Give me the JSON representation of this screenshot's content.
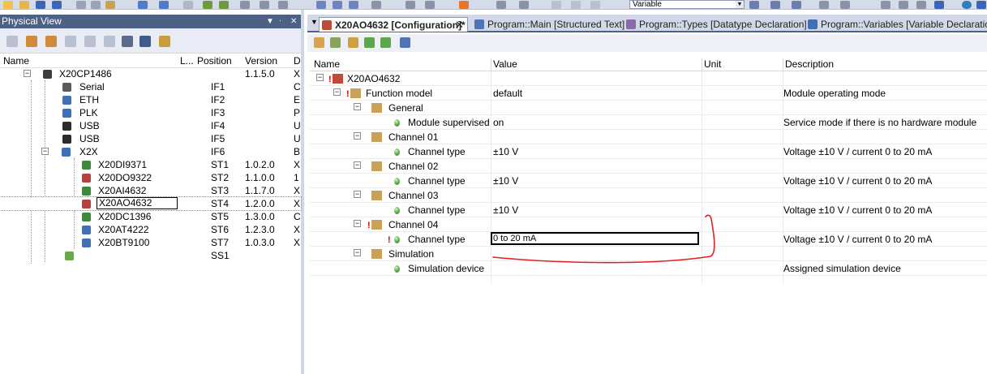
{
  "toolbar": {
    "variable_combo": "Variable"
  },
  "physical_view": {
    "title": "Physical View",
    "columns": [
      "Name",
      "L...",
      "Position",
      "Version",
      "D"
    ],
    "rows": [
      {
        "name": "X20CP1486",
        "position": "",
        "version": "1.1.5.0",
        "desc": "X"
      },
      {
        "name": "Serial",
        "position": "IF1",
        "version": "",
        "desc": "C"
      },
      {
        "name": "ETH",
        "position": "IF2",
        "version": "",
        "desc": "E"
      },
      {
        "name": "PLK",
        "position": "IF3",
        "version": "",
        "desc": "P"
      },
      {
        "name": "USB",
        "position": "IF4",
        "version": "",
        "desc": "U"
      },
      {
        "name": "USB",
        "position": "IF5",
        "version": "",
        "desc": "U"
      },
      {
        "name": "X2X",
        "position": "IF6",
        "version": "",
        "desc": "B"
      },
      {
        "name": "X20DI9371",
        "position": "ST1",
        "version": "1.0.2.0",
        "desc": "X"
      },
      {
        "name": "X20DO9322",
        "position": "ST2",
        "version": "1.1.0.0",
        "desc": "1"
      },
      {
        "name": "X20AI4632",
        "position": "ST3",
        "version": "1.1.7.0",
        "desc": "X"
      },
      {
        "name": "X20AO4632",
        "position": "ST4",
        "version": "1.2.0.0",
        "desc": "X"
      },
      {
        "name": "X20DC1396",
        "position": "ST5",
        "version": "1.3.0.0",
        "desc": "C"
      },
      {
        "name": "X20AT4222",
        "position": "ST6",
        "version": "1.2.3.0",
        "desc": "X"
      },
      {
        "name": "X20BT9100",
        "position": "ST7",
        "version": "1.0.3.0",
        "desc": "X"
      },
      {
        "name": "",
        "position": "SS1",
        "version": "",
        "desc": ""
      }
    ]
  },
  "tabs": [
    {
      "label": "X20AO4632 [Configuration]*",
      "close": "✕"
    },
    {
      "label": "Program::Main [Structured Text]"
    },
    {
      "label": "Program::Types [Datatype Declaration]"
    },
    {
      "label": "Program::Variables [Variable Declaration"
    }
  ],
  "grid": {
    "columns": [
      "Name",
      "Value",
      "Unit",
      "Description"
    ],
    "rows": [
      {
        "name": "X20AO4632",
        "value": "",
        "unit": "",
        "desc": ""
      },
      {
        "name": "Function model",
        "value": "default",
        "unit": "",
        "desc": "Module operating mode"
      },
      {
        "name": "General",
        "value": "",
        "unit": "",
        "desc": ""
      },
      {
        "name": "Module supervised",
        "value": "on",
        "unit": "",
        "desc": "Service mode if there is no hardware module"
      },
      {
        "name": "Channel 01",
        "value": "",
        "unit": "",
        "desc": ""
      },
      {
        "name": "Channel type",
        "value": "±10 V",
        "unit": "",
        "desc": "Voltage ±10 V / current 0 to 20 mA"
      },
      {
        "name": "Channel 02",
        "value": "",
        "unit": "",
        "desc": ""
      },
      {
        "name": "Channel type",
        "value": "±10 V",
        "unit": "",
        "desc": "Voltage ±10 V / current 0 to 20 mA"
      },
      {
        "name": "Channel 03",
        "value": "",
        "unit": "",
        "desc": ""
      },
      {
        "name": "Channel type",
        "value": "±10 V",
        "unit": "",
        "desc": "Voltage ±10 V / current 0 to 20 mA"
      },
      {
        "name": "Channel 04",
        "value": "",
        "unit": "",
        "desc": ""
      },
      {
        "name": "Channel type",
        "value": "0 to 20 mA",
        "unit": "",
        "desc": "Voltage ±10 V / current 0 to 20 mA"
      },
      {
        "name": "Simulation",
        "value": "",
        "unit": "",
        "desc": ""
      },
      {
        "name": "Simulation device",
        "value": "",
        "unit": "",
        "desc": "Assigned simulation device"
      }
    ]
  },
  "colors": {
    "title_bar": "#4d6185",
    "annotation": "#e02020",
    "led": "#3f9a2f"
  }
}
